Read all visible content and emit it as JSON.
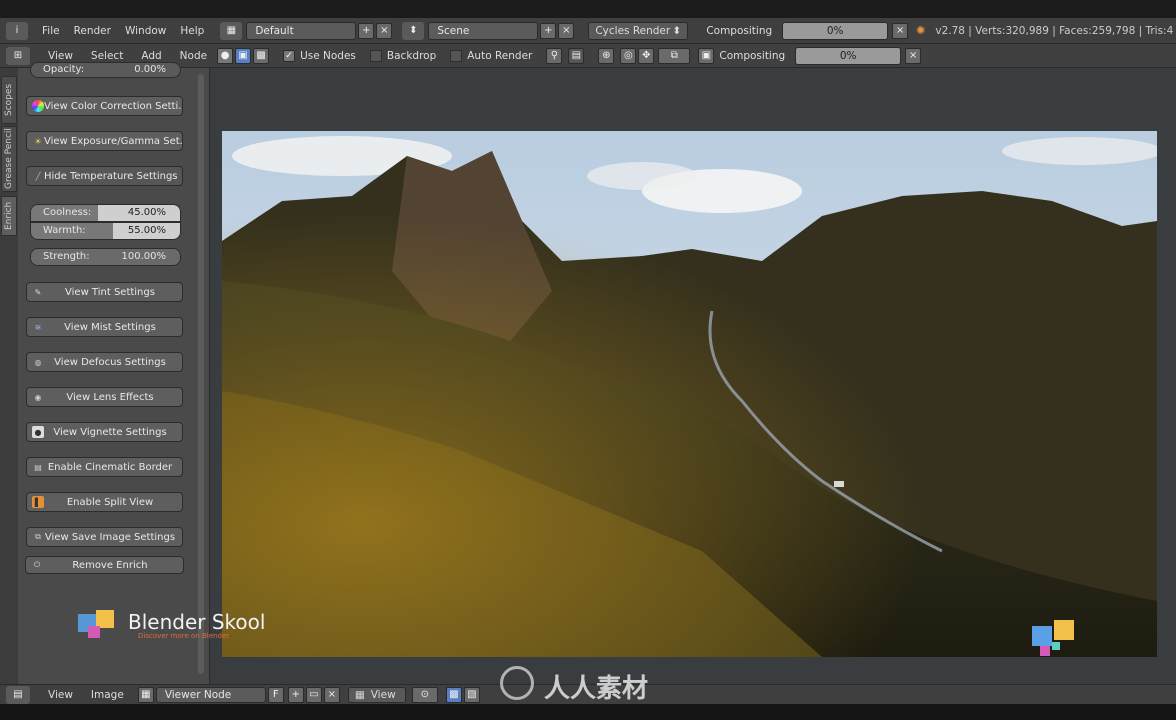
{
  "info_header": {
    "menus": [
      "File",
      "Render",
      "Window",
      "Help"
    ],
    "screen_layout": "Default",
    "scene": "Scene",
    "render_engine": "Cycles Render",
    "compositing_label": "Compositing",
    "progress": "0%",
    "stats": "v2.78 | Verts:320,989 | Faces:259,798 | Tris:4"
  },
  "node_header": {
    "menus": [
      "View",
      "Select",
      "Add",
      "Node"
    ],
    "use_nodes_label": "Use Nodes",
    "backdrop_label": "Backdrop",
    "auto_render_label": "Auto Render",
    "compositing_label": "Compositing",
    "progress": "0%"
  },
  "sidebar": {
    "tabs": [
      "Scopes",
      "Grease Pencil",
      "Enrich"
    ],
    "opacity": {
      "label": "Opacity:",
      "value": "0.00%"
    },
    "buttons": {
      "color_correction": "View Color Correction Setti...",
      "exposure_gamma": "View Exposure/Gamma Set...",
      "hide_temperature": "Hide Temperature Settings",
      "tint": "View Tint Settings",
      "mist": "View Mist Settings",
      "defocus": "View Defocus Settings",
      "lens": "View Lens Effects",
      "vignette": "View Vignette Settings",
      "cinematic": "Enable Cinematic Border",
      "split": "Enable Split View",
      "save_image": "View Save Image Settings",
      "remove": "Remove Enrich"
    },
    "coolness": {
      "label": "Coolness:",
      "value": "45.00%",
      "level": 0.45
    },
    "warmth": {
      "label": "Warmth:",
      "value": "55.00%",
      "level": 0.55
    },
    "strength": {
      "label": "Strength:",
      "value": "100.00%",
      "level": 1.0
    }
  },
  "bottom_header": {
    "menus": [
      "View",
      "Image"
    ],
    "image_name": "Viewer Node",
    "fake_user": "F",
    "view_select": "View"
  },
  "watermark": {
    "brand": "Blender Skool",
    "tagline": "Discover more on Blender",
    "site_mark": "人人素材"
  },
  "colors": {
    "header_bg": "#3f3f3f",
    "panel_bg": "#4a4a4a",
    "viewport_bg": "#3a3d40",
    "button_bg": "#5e5e5e"
  }
}
